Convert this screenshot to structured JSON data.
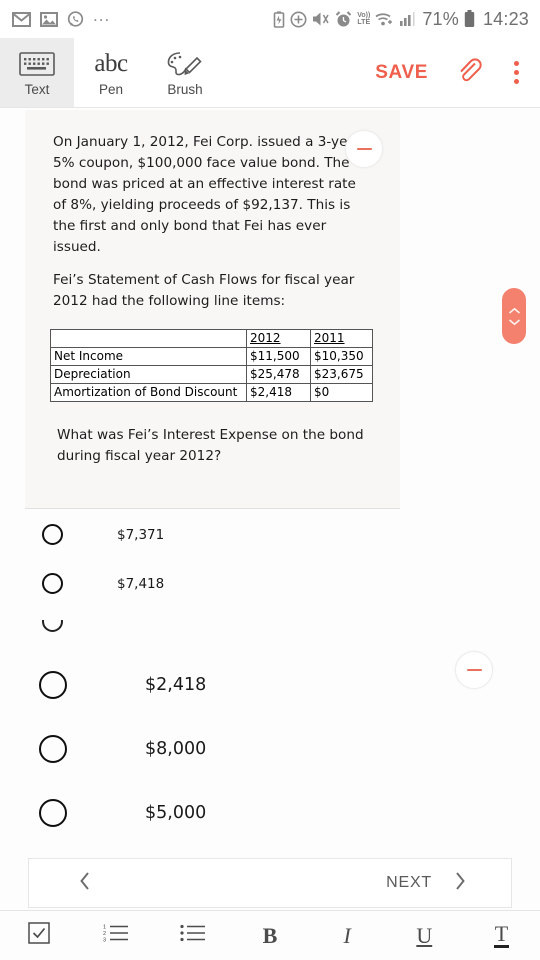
{
  "statusbar": {
    "left_icons": [
      "mail-icon",
      "image-icon",
      "whatsapp-icon"
    ],
    "overflow": "...",
    "right_icons": [
      "battery-saver-icon",
      "plus-circle-icon",
      "mute-icon",
      "alarm-icon",
      "volte-icon",
      "wifi-icon",
      "signal-icon"
    ],
    "volte_top": "Vo))",
    "volte_bottom": "LTE",
    "battery_percent": "71%",
    "time": "14:23"
  },
  "toolbar": {
    "tools": [
      {
        "label": "Text",
        "icon": "keyboard-icon",
        "active": true
      },
      {
        "label": "Pen",
        "icon": "abc-icon",
        "active": false
      },
      {
        "label": "Brush",
        "icon": "palette-brush-icon",
        "active": false
      }
    ],
    "save_label": "SAVE",
    "attach_icon": "paperclip-icon",
    "more_icon": "kebab-menu-icon",
    "accent_color": "#ef5f4c"
  },
  "question": {
    "stem": "On January 1, 2012, Fei Corp. issued a 3-year 5% coupon, $100,000 face value bond.  The bond was priced at an effective interest rate of 8%, yielding proceeds of $92,137.  This is the first and only bond that Fei has ever issued.",
    "intro": "Fei’s Statement of Cash Flows for fiscal year 2012 had the following line items:",
    "prompt": "What was Fei’s Interest Expense on the bond during fiscal year 2012?",
    "table": {
      "headers": [
        "",
        "2012",
        "2011"
      ],
      "rows": [
        [
          "Net Income",
          "$11,500",
          "$10,350"
        ],
        [
          "Depreciation",
          "$25,478",
          "$23,675"
        ],
        [
          "Amortization of Bond Discount",
          "$2,418",
          "$0"
        ]
      ]
    }
  },
  "options": [
    {
      "label": "$7,371",
      "size": "small",
      "selected": false
    },
    {
      "label": "$7,418",
      "size": "small",
      "selected": false
    },
    {
      "label": "$2,418",
      "size": "large",
      "selected": false
    },
    {
      "label": "$8,000",
      "size": "large",
      "selected": false
    },
    {
      "label": "$5,000",
      "size": "large",
      "selected": false
    }
  ],
  "overlays": {
    "bubble_icon": "minus-icon",
    "bubble_color": "#e8705c",
    "scroll_handle": {
      "up_icon": "chevron-up-icon",
      "down_icon": "chevron-down-icon",
      "color": "#f4806e"
    }
  },
  "navigation": {
    "prev_icon": "chevron-left-icon",
    "next_label": "NEXT",
    "next_icon": "chevron-right-icon"
  },
  "formatbar": {
    "items": [
      {
        "name": "checkbox-icon",
        "glyph": ""
      },
      {
        "name": "numbered-list-icon",
        "glyph": ""
      },
      {
        "name": "bulleted-list-icon",
        "glyph": ""
      },
      {
        "name": "bold-icon",
        "glyph": "B"
      },
      {
        "name": "italic-icon",
        "glyph": "I"
      },
      {
        "name": "underline-icon",
        "glyph": "U"
      },
      {
        "name": "text-color-icon",
        "glyph": "T"
      }
    ]
  }
}
